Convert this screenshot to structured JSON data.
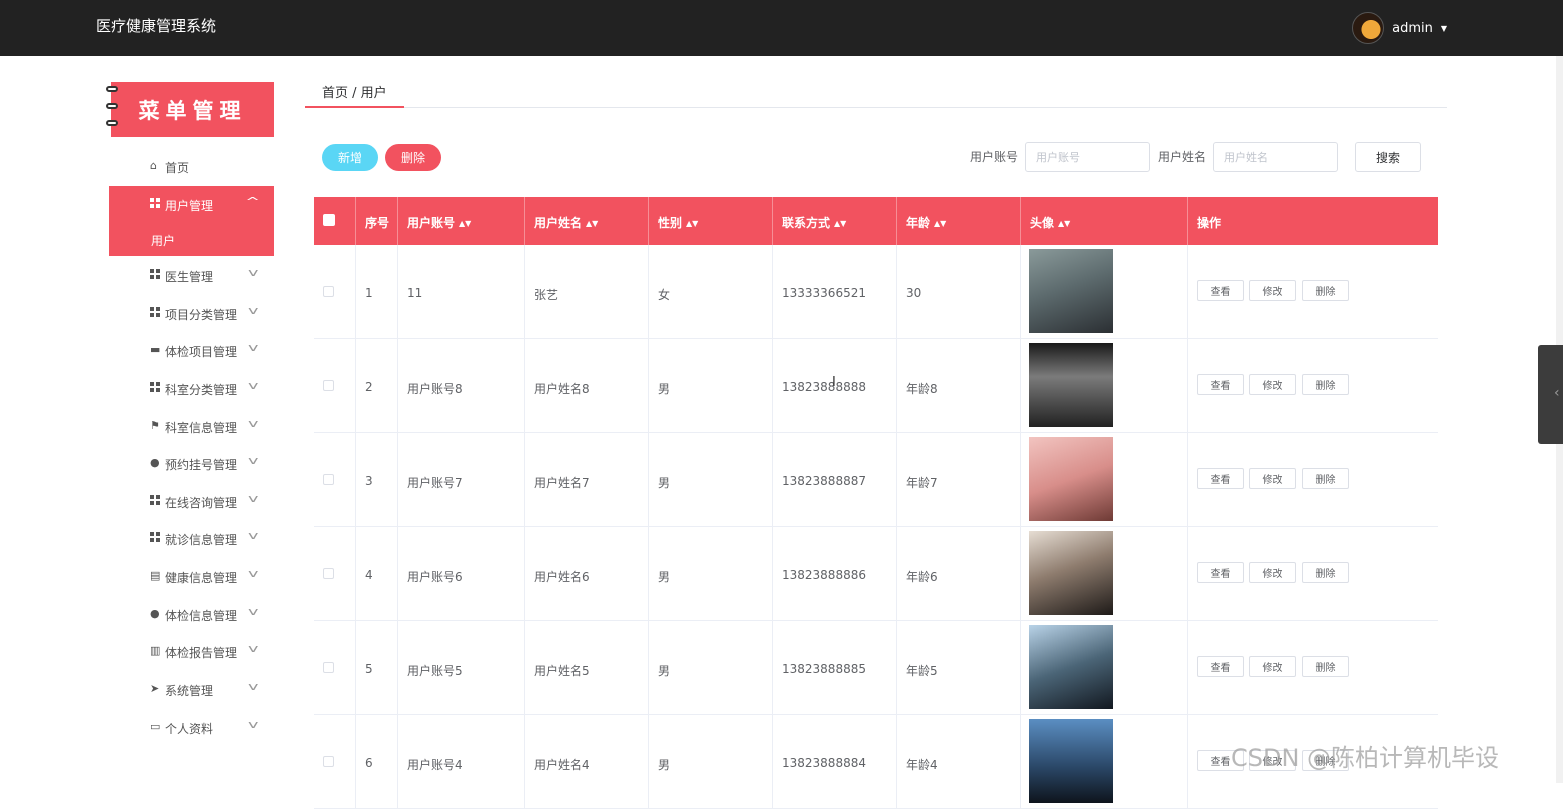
{
  "app_title": "医疗健康管理系统",
  "user": {
    "name": "admin"
  },
  "menu": {
    "banner": "菜单管理",
    "items": [
      {
        "label": "首页",
        "icon": "home-icon"
      },
      {
        "label": "用户管理",
        "icon": "grid-icon",
        "active": true
      },
      {
        "label": "医生管理",
        "icon": "grid-icon"
      },
      {
        "label": "项目分类管理",
        "icon": "grid-icon"
      },
      {
        "label": "体检项目管理",
        "icon": "briefcase-icon"
      },
      {
        "label": "科室分类管理",
        "icon": "grid-icon"
      },
      {
        "label": "科室信息管理",
        "icon": "flag-icon"
      },
      {
        "label": "预约挂号管理",
        "icon": "person-icon"
      },
      {
        "label": "在线咨询管理",
        "icon": "grid-icon"
      },
      {
        "label": "就诊信息管理",
        "icon": "grid-icon"
      },
      {
        "label": "健康信息管理",
        "icon": "clipboard-icon"
      },
      {
        "label": "体检信息管理",
        "icon": "pin-icon"
      },
      {
        "label": "体检报告管理",
        "icon": "chart-icon"
      },
      {
        "label": "系统管理",
        "icon": "send-icon"
      },
      {
        "label": "个人资料",
        "icon": "card-icon"
      }
    ],
    "sub_item": "用户"
  },
  "breadcrumb": "首页 / 用户",
  "toolbar": {
    "add_label": "新增",
    "delete_label": "删除"
  },
  "filters": {
    "account_label": "用户账号",
    "account_placeholder": "用户账号",
    "name_label": "用户姓名",
    "name_placeholder": "用户姓名",
    "search_label": "搜索"
  },
  "table": {
    "columns": [
      "序号",
      "用户账号",
      "用户姓名",
      "性别",
      "联系方式",
      "年龄",
      "头像",
      "操作"
    ],
    "rows": [
      {
        "index": "1",
        "account": "11",
        "name": "张艺",
        "gender": "女",
        "phone": "13333366521",
        "age": "30"
      },
      {
        "index": "2",
        "account": "用户账号8",
        "name": "用户姓名8",
        "gender": "男",
        "phone": "13823888888",
        "age": "年龄8"
      },
      {
        "index": "3",
        "account": "用户账号7",
        "name": "用户姓名7",
        "gender": "男",
        "phone": "13823888887",
        "age": "年龄7"
      },
      {
        "index": "4",
        "account": "用户账号6",
        "name": "用户姓名6",
        "gender": "男",
        "phone": "13823888886",
        "age": "年龄6"
      },
      {
        "index": "5",
        "account": "用户账号5",
        "name": "用户姓名5",
        "gender": "男",
        "phone": "13823888885",
        "age": "年龄5"
      },
      {
        "index": "6",
        "account": "用户账号4",
        "name": "用户姓名4",
        "gender": "男",
        "phone": "13823888884",
        "age": "年龄4"
      }
    ],
    "actions": [
      "查看",
      "修改",
      "删除"
    ]
  },
  "watermark": "CSDN @陈柏计算机毕设",
  "colors": {
    "accent": "#f2525f",
    "add_button": "#5ad6f5",
    "topbar": "#222222"
  }
}
